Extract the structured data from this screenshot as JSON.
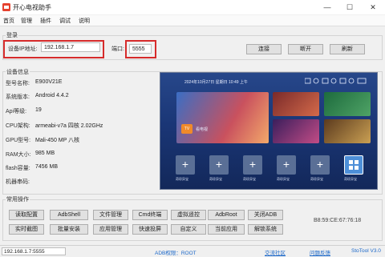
{
  "window": {
    "title": "开心电视助手",
    "min_glyph": "—",
    "max_glyph": "☐",
    "close_glyph": "✕"
  },
  "menu": [
    "首页",
    "管理",
    "插件",
    "调试",
    "说明"
  ],
  "login": {
    "group_label": "登录",
    "ip_label": "设备IP地址:",
    "ip_value": "192.168.1.7",
    "port_label": "端口:",
    "port_value": "5555",
    "connect": "连接",
    "disconnect": "断开",
    "refresh": "刷新"
  },
  "device": {
    "group_label": "设备信息",
    "rows": [
      {
        "label": "型号名称:",
        "value": "E900V21E"
      },
      {
        "label": "系统版本:",
        "value": "Android 4.4.2"
      },
      {
        "label": "Api等级:",
        "value": "19"
      },
      {
        "label": "CPU架构:",
        "value": "armeabi-v7a 四核 2.02GHz"
      },
      {
        "label": "GPU型号:",
        "value": "Mali-450 MP 八核"
      },
      {
        "label": "RAM大小:",
        "value": "985 MB"
      },
      {
        "label": "flash容量:",
        "value": "7456 MB"
      },
      {
        "label": "机器串码:",
        "value": ""
      }
    ]
  },
  "tv": {
    "datetime": "2024年10月27日  星期日  10:49 上午",
    "featured_label": "看电视",
    "featured_badge": "TV",
    "app_labels": [
      "奇珍异宝",
      "奇珍异宝",
      "奇珍异宝",
      "奇珍异宝",
      "奇珍异宝",
      "奇珍异宝"
    ]
  },
  "ops": {
    "group_label": "常用操作",
    "row1": [
      "读取配置",
      "AdbShell",
      "文件管理",
      "Cmd终端",
      "虚拟遥控",
      "AdbRoot",
      "关闭ADB"
    ],
    "row2": [
      "实时截图",
      "批量安装",
      "应用管理",
      "快速投屏",
      "自定义",
      "当前应用",
      "解锁系统"
    ],
    "mac": "B8:59:CE:67:76:18"
  },
  "status": {
    "ip": "192.168.1.7:5555",
    "adb": "ADB权限：ROOT",
    "community": "交流社区",
    "feedback": "问题反馈",
    "version": "StoTool V3.0"
  },
  "colors": {
    "highlight": "#d62b2b",
    "accent": "#1a67c9"
  }
}
